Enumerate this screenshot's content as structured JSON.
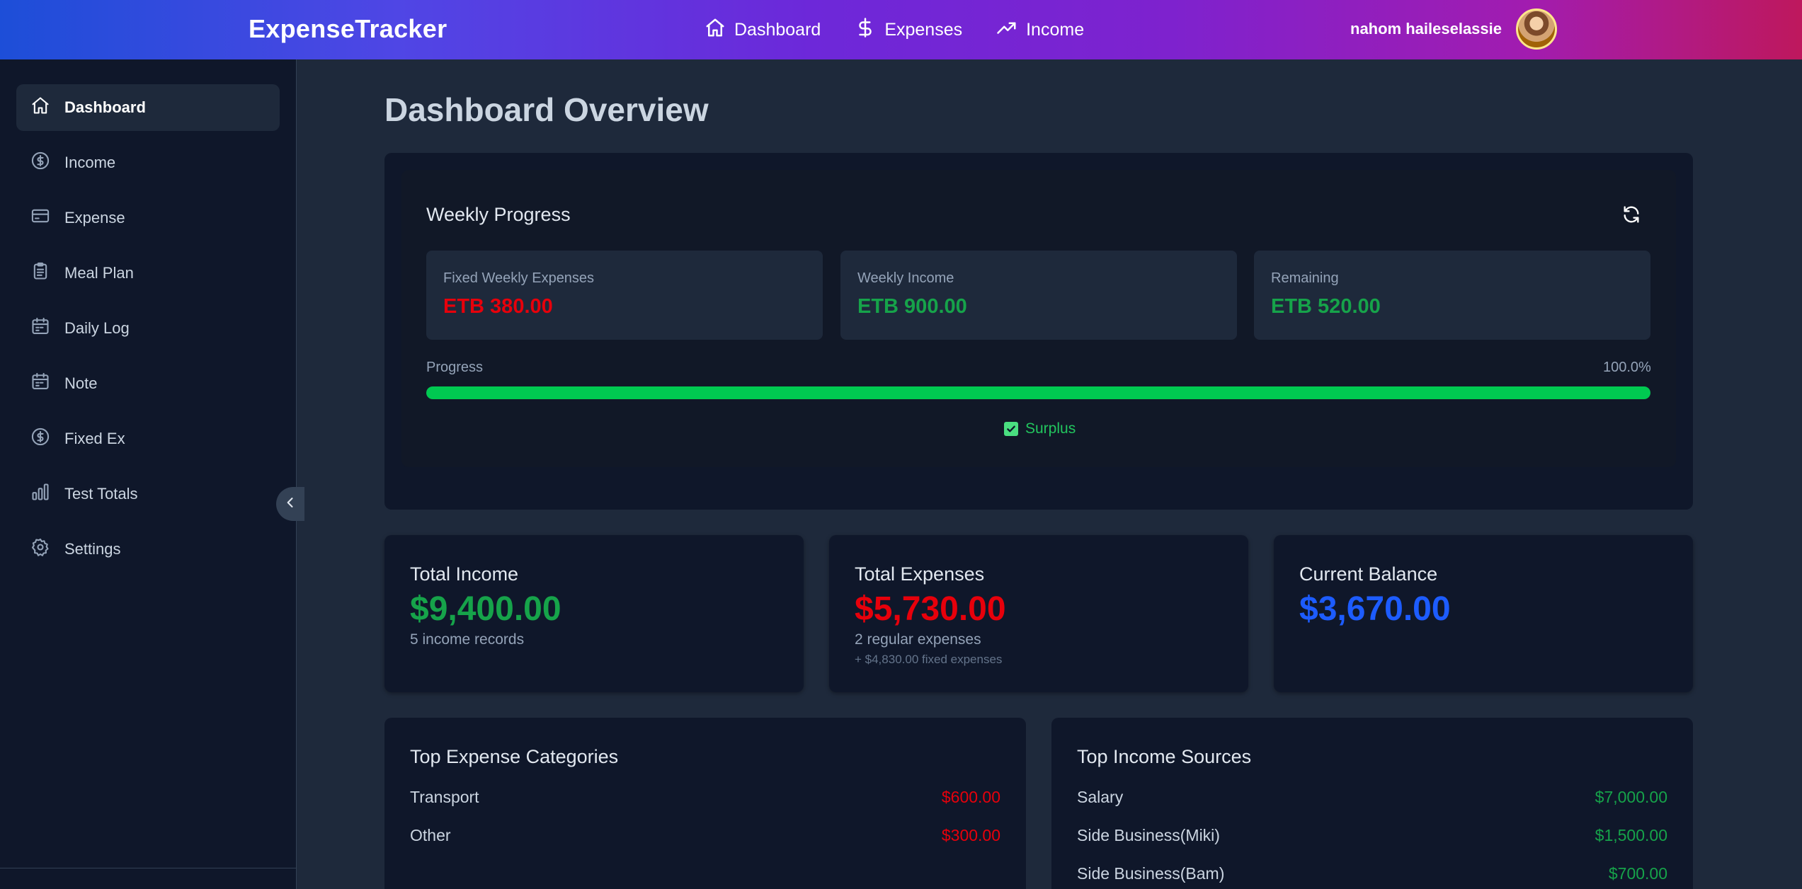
{
  "app": {
    "brand": "ExpenseTracker"
  },
  "topnav": {
    "items": [
      {
        "label": "Dashboard",
        "icon": "home-icon"
      },
      {
        "label": "Expenses",
        "icon": "dollar-icon"
      },
      {
        "label": "Income",
        "icon": "trending-up-icon"
      }
    ],
    "user_name": "nahom haileselassie"
  },
  "sidebar": {
    "items": [
      {
        "label": "Dashboard",
        "icon": "home-icon",
        "active": true
      },
      {
        "label": "Income",
        "icon": "dollar-circle-icon"
      },
      {
        "label": "Expense",
        "icon": "credit-card-icon"
      },
      {
        "label": "Meal Plan",
        "icon": "clipboard-list-icon"
      },
      {
        "label": "Daily Log",
        "icon": "calendar-icon"
      },
      {
        "label": "Note",
        "icon": "calendar-icon"
      },
      {
        "label": "Fixed Ex",
        "icon": "dollar-circle-icon"
      },
      {
        "label": "Test Totals",
        "icon": "bar-chart-icon"
      },
      {
        "label": "Settings",
        "icon": "gear-icon"
      }
    ]
  },
  "main": {
    "page_title": "Dashboard Overview",
    "weekly": {
      "title": "Weekly Progress",
      "fixed_label": "Fixed Weekly Expenses",
      "fixed_value": "ETB 380.00",
      "income_label": "Weekly Income",
      "income_value": "ETB 900.00",
      "remaining_label": "Remaining",
      "remaining_value": "ETB 520.00",
      "progress_label": "Progress",
      "progress_pct_text": "100.0%",
      "progress_fraction": 1.0,
      "status": "Surplus"
    },
    "summary": {
      "income_title": "Total Income",
      "income_value": "$9,400.00",
      "income_sub": "5 income records",
      "expenses_title": "Total Expenses",
      "expenses_value": "$5,730.00",
      "expenses_sub": "2 regular expenses",
      "expenses_sub2": "+ $4,830.00 fixed expenses",
      "balance_title": "Current Balance",
      "balance_value": "$3,670.00"
    },
    "top_expenses": {
      "title": "Top Expense Categories",
      "rows": [
        {
          "name": "Transport",
          "amount": "$600.00"
        },
        {
          "name": "Other",
          "amount": "$300.00"
        }
      ]
    },
    "top_income": {
      "title": "Top Income Sources",
      "rows": [
        {
          "name": "Salary",
          "amount": "$7,000.00"
        },
        {
          "name": "Side Business(Miki)",
          "amount": "$1,500.00"
        },
        {
          "name": "Side Business(Bam)",
          "amount": "$700.00"
        }
      ]
    }
  },
  "colors": {
    "income_green": "#16a34a",
    "expense_red": "#e7000b",
    "balance_blue": "#1d5cff",
    "progress_green": "#00c951"
  }
}
